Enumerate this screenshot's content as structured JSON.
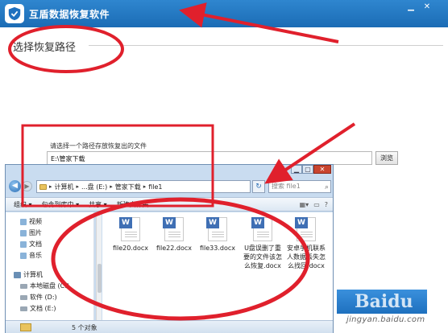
{
  "app": {
    "title": "互盾数据恢复软件",
    "section_title": "选择恢复路径",
    "prompt": "请选择一个路径存放恢复出的文件",
    "path_value": "E:\\管家下载",
    "browse_label": "浏览",
    "window_buttons": {
      "minimize": "▁",
      "close": "✕"
    },
    "logo_icon": "shield-check-icon",
    "accent_color": "#1e70bf"
  },
  "dialog": {
    "address": [
      "计算机",
      "...盘 (E:)",
      "管家下载",
      "file1"
    ],
    "search_placeholder": "搜索 file1",
    "toolbar": [
      "组织 ▾",
      "包含到库中 ▾",
      "共享 ▾",
      "新建文件夹"
    ],
    "sidebar": [
      {
        "label": "视频",
        "icon": "library-icon"
      },
      {
        "label": "图片",
        "icon": "library-icon"
      },
      {
        "label": "文档",
        "icon": "library-icon"
      },
      {
        "label": "音乐",
        "icon": "library-icon"
      },
      {
        "label": "计算机",
        "icon": "computer-icon"
      },
      {
        "label": "本地磁盘 (C:)",
        "icon": "drive-icon"
      },
      {
        "label": "软件 (D:)",
        "icon": "drive-icon"
      },
      {
        "label": "文档 (E:)",
        "icon": "drive-icon"
      }
    ],
    "files": [
      {
        "name": "file20.docx"
      },
      {
        "name": "file22.docx"
      },
      {
        "name": "file33.docx"
      },
      {
        "name": "U盘误删了重要的文件该怎么恢复.docx"
      },
      {
        "name": "安卓手机联系人数据丢失怎么找回.docx"
      }
    ],
    "status": "5 个对象"
  },
  "watermark": "jingyan.baidu.com",
  "watermark_logo": "Baidu"
}
